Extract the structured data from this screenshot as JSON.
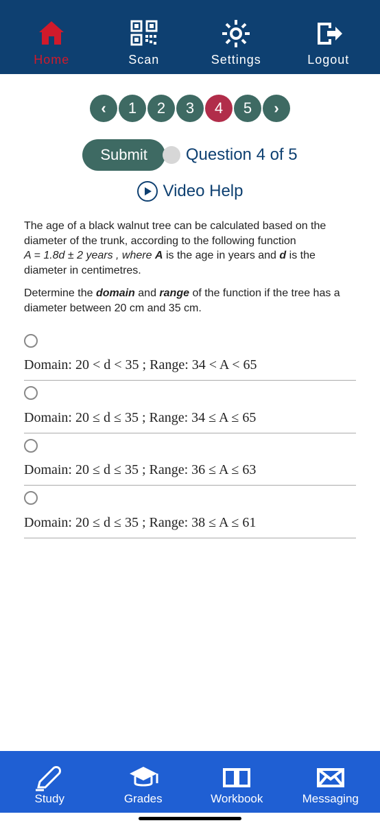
{
  "top_nav": {
    "home": "Home",
    "scan": "Scan",
    "settings": "Settings",
    "logout": "Logout"
  },
  "qnav": {
    "prev": "‹",
    "q1": "1",
    "q2": "2",
    "q3": "3",
    "q4": "4",
    "q5": "5",
    "next": "›"
  },
  "submit_label": "Submit",
  "counter": "Question 4 of 5",
  "video_help": "Video Help",
  "question": {
    "line1": "The age of a black walnut tree can be calculated based on the diameter of the trunk, according to the following function",
    "formula_prefix": "A = 1.8d ± 2 years , where ",
    "formula_a": "A",
    "formula_mid": " is the age in years and ",
    "formula_d": "d",
    "formula_suffix": " is the diameter in centimetres.",
    "line2_prefix": "Determine the ",
    "domain_word": "domain",
    "line2_and": " and ",
    "range_word": "range",
    "line2_suffix": " of the function if the tree has a diameter between 20 cm and 35 cm."
  },
  "choices": {
    "a": "Domain: 20 < d < 35 ; Range: 34 < A < 65",
    "b": "Domain: 20 ≤ d ≤ 35 ; Range: 34 ≤ A ≤ 65",
    "c": "Domain: 20 ≤ d ≤ 35 ; Range: 36 ≤ A ≤ 63",
    "d": "Domain: 20 ≤ d ≤ 35 ; Range: 38 ≤ A ≤ 61"
  },
  "bottom_nav": {
    "study": "Study",
    "grades": "Grades",
    "workbook": "Workbook",
    "messaging": "Messaging"
  }
}
